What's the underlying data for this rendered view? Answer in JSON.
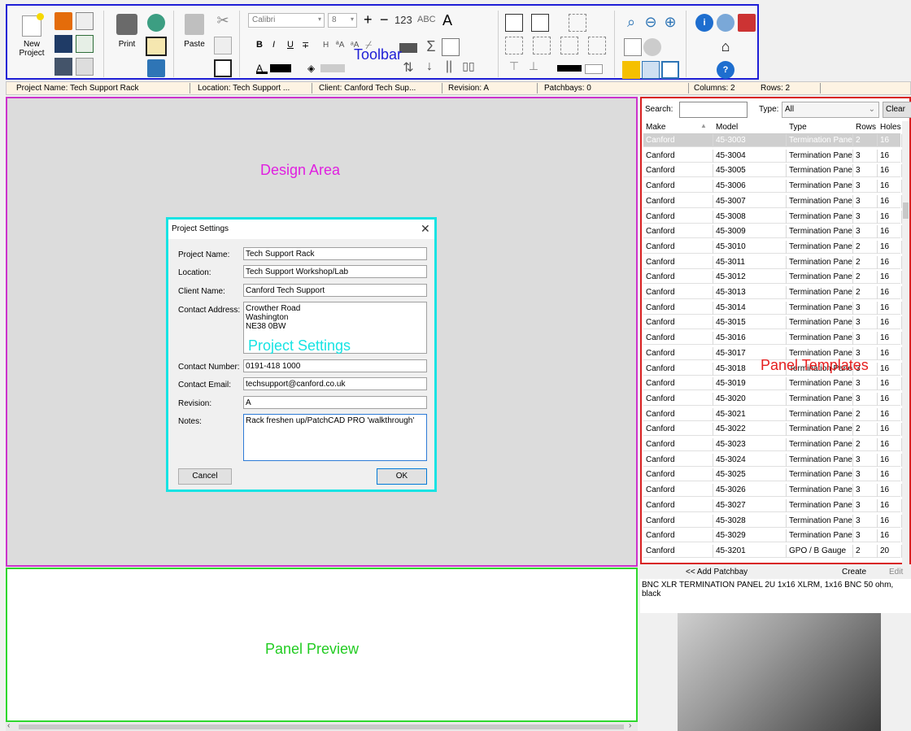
{
  "toolbar": {
    "overlay_label": "Toolbar",
    "new_project": "New\nProject",
    "print": "Print",
    "paste": "Paste",
    "font_name": "Calibri",
    "font_size": "8",
    "bold": "B",
    "italic": "I",
    "underline": "U",
    "strike": "∓",
    "h_label": "H",
    "aa_label": "ªA",
    "aa2_label": "ᵃA",
    "plus": "+",
    "minus": "−",
    "num_label": "123",
    "abc_label": "ABC"
  },
  "statusbar": {
    "project_name": "Project Name: Tech Support Rack",
    "location": "Location: Tech Support ...",
    "client": "Client: Canford Tech Sup...",
    "revision": "Revision: A",
    "patchbays": "Patchbays: 0",
    "columns": "Columns: 2",
    "rows": "Rows: 2"
  },
  "design": {
    "overlay_label": "Design Area"
  },
  "preview": {
    "overlay_label": "Panel Preview"
  },
  "dialog": {
    "title": "Project Settings",
    "overlay_label": "Project Settings",
    "fields": {
      "project_name_label": "Project Name:",
      "project_name": "Tech Support Rack",
      "location_label": "Location:",
      "location": "Tech Support Workshop/Lab",
      "client_label": "Client Name:",
      "client": "Canford Tech Support",
      "address_label": "Contact Address:",
      "address": "Crowther Road\nWashington\nNE38 0BW",
      "number_label": "Contact Number:",
      "number": "0191-418 1000",
      "email_label": "Contact Email:",
      "email": "techsupport@canford.co.uk",
      "revision_label": "Revision:",
      "revision": "A",
      "notes_label": "Notes:",
      "notes": "Rack freshen up/PatchCAD PRO 'walkthrough'"
    },
    "cancel": "Cancel",
    "ok": "OK"
  },
  "templates": {
    "overlay_label": "Panel Templates",
    "search_label": "Search:",
    "type_label": "Type:",
    "type_value": "All",
    "clear": "Clear",
    "columns": [
      "Make",
      "Model",
      "Type",
      "Rows",
      "Holes"
    ],
    "rows": [
      [
        "Canford",
        "45-3003",
        "Termination Panel",
        "2",
        "16"
      ],
      [
        "Canford",
        "45-3004",
        "Termination Panel",
        "3",
        "16"
      ],
      [
        "Canford",
        "45-3005",
        "Termination Panel",
        "3",
        "16"
      ],
      [
        "Canford",
        "45-3006",
        "Termination Panel",
        "3",
        "16"
      ],
      [
        "Canford",
        "45-3007",
        "Termination Panel",
        "3",
        "16"
      ],
      [
        "Canford",
        "45-3008",
        "Termination Panel",
        "3",
        "16"
      ],
      [
        "Canford",
        "45-3009",
        "Termination Panel",
        "3",
        "16"
      ],
      [
        "Canford",
        "45-3010",
        "Termination Panel",
        "2",
        "16"
      ],
      [
        "Canford",
        "45-3011",
        "Termination Panel",
        "2",
        "16"
      ],
      [
        "Canford",
        "45-3012",
        "Termination Panel",
        "2",
        "16"
      ],
      [
        "Canford",
        "45-3013",
        "Termination Panel",
        "2",
        "16"
      ],
      [
        "Canford",
        "45-3014",
        "Termination Panel",
        "3",
        "16"
      ],
      [
        "Canford",
        "45-3015",
        "Termination Panel",
        "3",
        "16"
      ],
      [
        "Canford",
        "45-3016",
        "Termination Panel",
        "3",
        "16"
      ],
      [
        "Canford",
        "45-3017",
        "Termination Panel",
        "3",
        "16"
      ],
      [
        "Canford",
        "45-3018",
        "Termination Panel",
        "3",
        "16"
      ],
      [
        "Canford",
        "45-3019",
        "Termination Panel",
        "3",
        "16"
      ],
      [
        "Canford",
        "45-3020",
        "Termination Panel",
        "3",
        "16"
      ],
      [
        "Canford",
        "45-3021",
        "Termination Panel",
        "2",
        "16"
      ],
      [
        "Canford",
        "45-3022",
        "Termination Panel",
        "2",
        "16"
      ],
      [
        "Canford",
        "45-3023",
        "Termination Panel",
        "2",
        "16"
      ],
      [
        "Canford",
        "45-3024",
        "Termination Panel",
        "3",
        "16"
      ],
      [
        "Canford",
        "45-3025",
        "Termination Panel",
        "3",
        "16"
      ],
      [
        "Canford",
        "45-3026",
        "Termination Panel",
        "3",
        "16"
      ],
      [
        "Canford",
        "45-3027",
        "Termination Panel",
        "3",
        "16"
      ],
      [
        "Canford",
        "45-3028",
        "Termination Panel",
        "3",
        "16"
      ],
      [
        "Canford",
        "45-3029",
        "Termination Panel",
        "3",
        "16"
      ],
      [
        "Canford",
        "45-3201",
        "GPO / B Gauge",
        "2",
        "20"
      ]
    ],
    "add_patchbay": "<< Add Patchbay",
    "create": "Create",
    "edit": "Edit",
    "description": "BNC XLR TERMINATION PANEL 2U 1x16 XLRM, 1x16 BNC 50 ohm, black"
  }
}
